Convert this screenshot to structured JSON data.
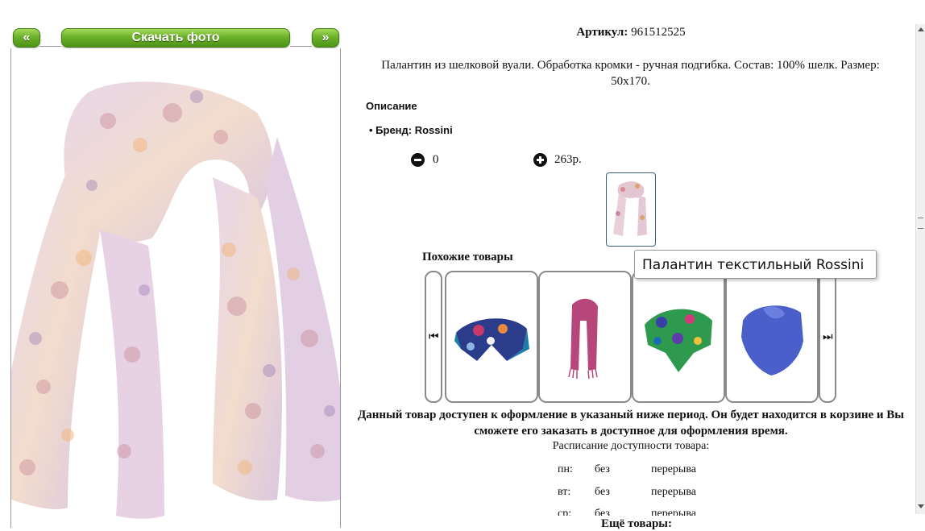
{
  "gallery": {
    "prev_label": "«",
    "download_label": "Скачать фото",
    "next_label": "»"
  },
  "product": {
    "sku_label": "Артикул:",
    "sku_value": "961512525",
    "description": "Палантин из шелковой вуали. Обработка кромки - ручная подгибка. Состав: 100% шелк. Размер: 50х170.",
    "details_heading": "Описание",
    "brand_item": "Бренд: Rossini",
    "quantity": "0",
    "price": "263р."
  },
  "similar": {
    "heading": "Похожие товары",
    "tooltip": "Палантин текстильный Rossini",
    "items": [
      {
        "icon": "scarf-navy-floral"
      },
      {
        "icon": "scarf-pink"
      },
      {
        "icon": "scarf-green-floral"
      },
      {
        "icon": "scarf-blue"
      }
    ]
  },
  "availability": {
    "notice": "Данный товар доступен к оформление в указаный ниже период. Он будет находится в корзине и Вы сможете его заказать в доступное для оформления время.",
    "schedule_title": "Расписание доступности товара:",
    "rows": [
      {
        "day": "пн:",
        "from": "без",
        "to": "перерыва"
      },
      {
        "day": "вт:",
        "from": "без",
        "to": "перерыва"
      },
      {
        "day": "ср:",
        "from": "без",
        "to": "перерыва"
      }
    ]
  },
  "more": {
    "heading": "Ещё товары:"
  }
}
